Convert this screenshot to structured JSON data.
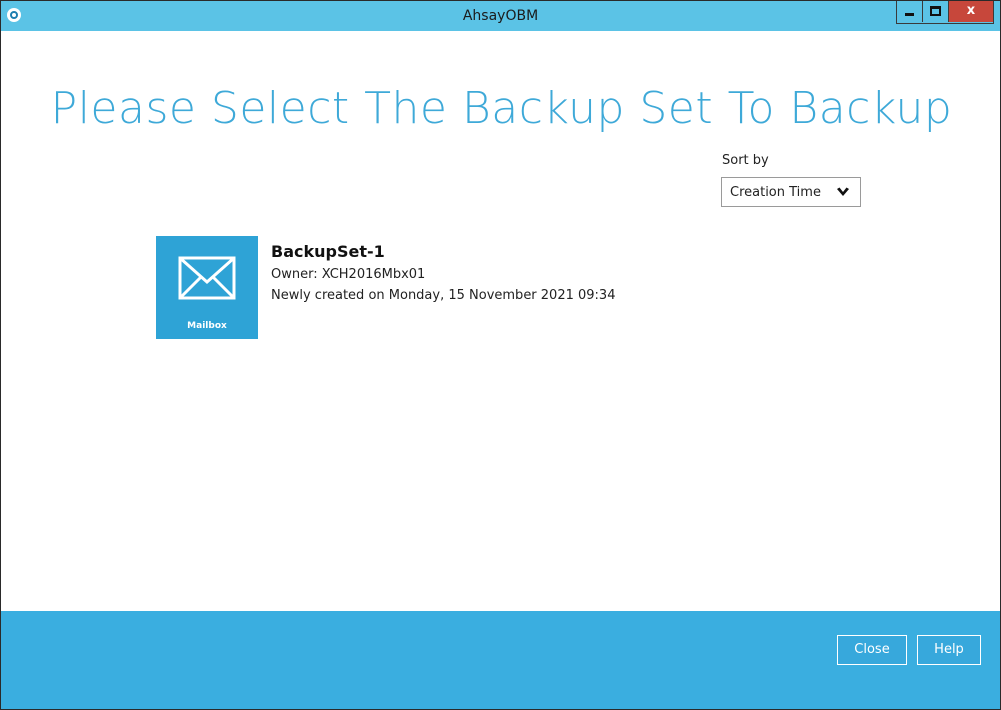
{
  "window": {
    "title": "AhsayOBM",
    "close_glyph": "x"
  },
  "main": {
    "heading": "Please Select The Backup Set To Backup",
    "sort": {
      "label": "Sort by",
      "selected": "Creation Time"
    },
    "backup_sets": [
      {
        "name": "BackupSet-1",
        "owner": "Owner: XCH2016Mbx01",
        "created": "Newly created on Monday, 15 November 2021 09:34",
        "type_label": "Mailbox",
        "icon": "envelope-icon"
      }
    ]
  },
  "footer": {
    "close_label": "Close",
    "help_label": "Help"
  },
  "colors": {
    "titlebar": "#5bc3e6",
    "accent": "#3ea9d8",
    "tile": "#2ea3d6",
    "footer": "#3aaee0",
    "close_button": "#c7473b"
  }
}
